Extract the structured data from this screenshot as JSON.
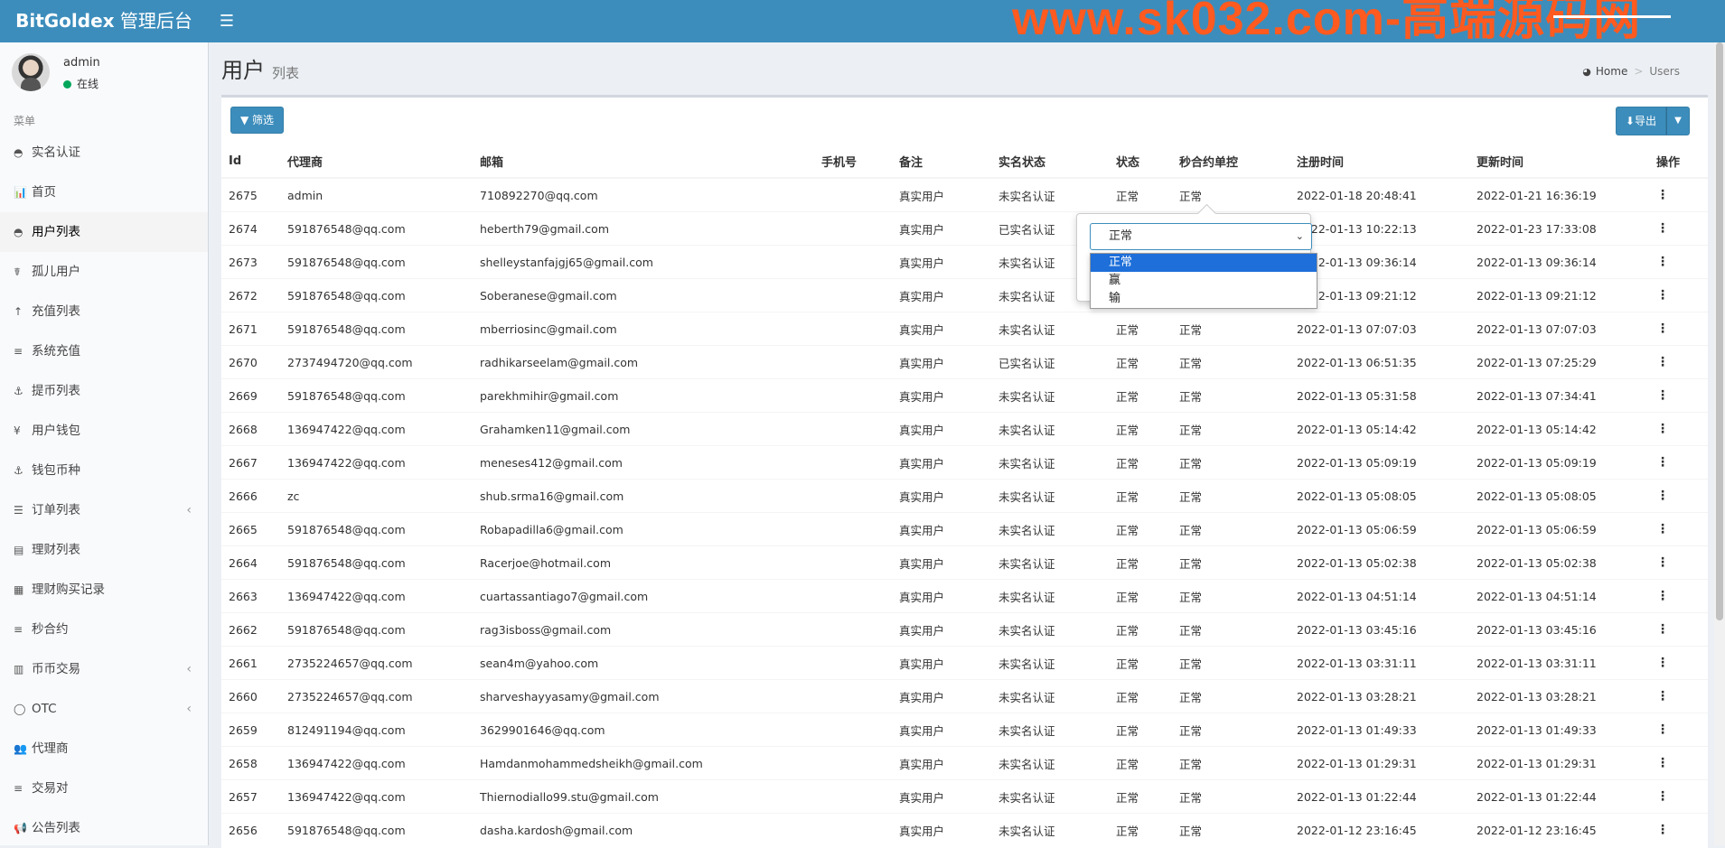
{
  "header": {
    "brand_bold": "BitGoldex",
    "brand_rest": " 管理后台",
    "toggle_icon": "hamburger-icon",
    "watermark": "www.sk032.com-高端源码网"
  },
  "user": {
    "name": "admin",
    "status": "在线"
  },
  "menu_header": "菜单",
  "menu": [
    {
      "icon": "◓",
      "label": "实名认证"
    },
    {
      "icon": "📊",
      "label": "首页"
    },
    {
      "icon": "◓",
      "label": "用户列表",
      "active": true
    },
    {
      "icon": "☤",
      "label": "孤儿用户"
    },
    {
      "icon": "↑",
      "label": "充值列表"
    },
    {
      "icon": "≡",
      "label": "系统充值"
    },
    {
      "icon": "⚓",
      "label": "提币列表"
    },
    {
      "icon": "¥",
      "label": "用户钱包"
    },
    {
      "icon": "⚓",
      "label": "钱包币种"
    },
    {
      "icon": "☰",
      "label": "订单列表",
      "caret": "‹"
    },
    {
      "icon": "▤",
      "label": "理财列表"
    },
    {
      "icon": "▦",
      "label": "理财购买记录"
    },
    {
      "icon": "≡",
      "label": "秒合约"
    },
    {
      "icon": "▥",
      "label": "币币交易",
      "caret": "‹"
    },
    {
      "icon": "◯",
      "label": "OTC",
      "caret": "‹"
    },
    {
      "icon": "👥",
      "label": "代理商"
    },
    {
      "icon": "≡",
      "label": "交易对"
    },
    {
      "icon": "📢",
      "label": "公告列表"
    }
  ],
  "page": {
    "title": "用户",
    "subtitle": "列表"
  },
  "breadcrumb": {
    "home": "Home",
    "current": "Users"
  },
  "toolbar": {
    "filter": "筛选",
    "export": "导出"
  },
  "table": {
    "headers": [
      "Id",
      "代理商",
      "邮箱",
      "手机号",
      "备注",
      "实名状态",
      "状态",
      "秒合约单控",
      "注册时间",
      "更新时间",
      "操作"
    ],
    "rows": [
      [
        "2675",
        "admin",
        "710892270@qq.com",
        "",
        "真实用户",
        "未实名认证",
        "正常",
        "正常",
        "2022-01-18 20:48:41",
        "2022-01-21 16:36:19",
        "⋮"
      ],
      [
        "2674",
        "591876548@qq.com",
        "heberth79@gmail.com",
        "",
        "真实用户",
        "已实名认证",
        "正常",
        "正常",
        "2022-01-13 10:22:13",
        "2022-01-23 17:33:08",
        "⋮"
      ],
      [
        "2673",
        "591876548@qq.com",
        "shelleystanfajgj65@gmail.com",
        "",
        "真实用户",
        "未实名认证",
        "正常",
        "正常",
        "2022-01-13 09:36:14",
        "2022-01-13 09:36:14",
        "⋮"
      ],
      [
        "2672",
        "591876548@qq.com",
        "Soberanese@gmail.com",
        "",
        "真实用户",
        "未实名认证",
        "正常",
        "正常",
        "2022-01-13 09:21:12",
        "2022-01-13 09:21:12",
        "⋮"
      ],
      [
        "2671",
        "591876548@qq.com",
        "mberriosinc@gmail.com",
        "",
        "真实用户",
        "未实名认证",
        "正常",
        "正常",
        "2022-01-13 07:07:03",
        "2022-01-13 07:07:03",
        "⋮"
      ],
      [
        "2670",
        "2737494720@qq.com",
        "radhikarseelam@gmail.com",
        "",
        "真实用户",
        "已实名认证",
        "正常",
        "正常",
        "2022-01-13 06:51:35",
        "2022-01-13 07:25:29",
        "⋮"
      ],
      [
        "2669",
        "591876548@qq.com",
        "parekhmihir@gmail.com",
        "",
        "真实用户",
        "未实名认证",
        "正常",
        "正常",
        "2022-01-13 05:31:58",
        "2022-01-13 07:34:41",
        "⋮"
      ],
      [
        "2668",
        "136947422@qq.com",
        "Grahamken11@gmail.com",
        "",
        "真实用户",
        "未实名认证",
        "正常",
        "正常",
        "2022-01-13 05:14:42",
        "2022-01-13 05:14:42",
        "⋮"
      ],
      [
        "2667",
        "136947422@qq.com",
        "meneses412@gmail.com",
        "",
        "真实用户",
        "未实名认证",
        "正常",
        "正常",
        "2022-01-13 05:09:19",
        "2022-01-13 05:09:19",
        "⋮"
      ],
      [
        "2666",
        "zc",
        "shub.srma16@gmail.com",
        "",
        "真实用户",
        "未实名认证",
        "正常",
        "正常",
        "2022-01-13 05:08:05",
        "2022-01-13 05:08:05",
        "⋮"
      ],
      [
        "2665",
        "591876548@qq.com",
        "Robapadilla6@gmail.com",
        "",
        "真实用户",
        "未实名认证",
        "正常",
        "正常",
        "2022-01-13 05:06:59",
        "2022-01-13 05:06:59",
        "⋮"
      ],
      [
        "2664",
        "591876548@qq.com",
        "Racerjoe@hotmail.com",
        "",
        "真实用户",
        "未实名认证",
        "正常",
        "正常",
        "2022-01-13 05:02:38",
        "2022-01-13 05:02:38",
        "⋮"
      ],
      [
        "2663",
        "136947422@qq.com",
        "cuartassantiago7@gmail.com",
        "",
        "真实用户",
        "未实名认证",
        "正常",
        "正常",
        "2022-01-13 04:51:14",
        "2022-01-13 04:51:14",
        "⋮"
      ],
      [
        "2662",
        "591876548@qq.com",
        "rag3isboss@gmail.com",
        "",
        "真实用户",
        "未实名认证",
        "正常",
        "正常",
        "2022-01-13 03:45:16",
        "2022-01-13 03:45:16",
        "⋮"
      ],
      [
        "2661",
        "2735224657@qq.com",
        "sean4m@yahoo.com",
        "",
        "真实用户",
        "未实名认证",
        "正常",
        "正常",
        "2022-01-13 03:31:11",
        "2022-01-13 03:31:11",
        "⋮"
      ],
      [
        "2660",
        "2735224657@qq.com",
        "sharveshayyasamy@gmail.com",
        "",
        "真实用户",
        "未实名认证",
        "正常",
        "正常",
        "2022-01-13 03:28:21",
        "2022-01-13 03:28:21",
        "⋮"
      ],
      [
        "2659",
        "812491194@qq.com",
        "3629901646@qq.com",
        "",
        "真实用户",
        "未实名认证",
        "正常",
        "正常",
        "2022-01-13 01:49:33",
        "2022-01-13 01:49:33",
        "⋮"
      ],
      [
        "2658",
        "136947422@qq.com",
        "Hamdanmohammedsheikh@gmail.com",
        "",
        "真实用户",
        "未实名认证",
        "正常",
        "正常",
        "2022-01-13 01:29:31",
        "2022-01-13 01:29:31",
        "⋮"
      ],
      [
        "2657",
        "136947422@qq.com",
        "Thiernodiallo99.stu@gmail.com",
        "",
        "真实用户",
        "未实名认证",
        "正常",
        "正常",
        "2022-01-13 01:22:44",
        "2022-01-13 01:22:44",
        "⋮"
      ],
      [
        "2656",
        "591876548@qq.com",
        "dasha.kardosh@gmail.com",
        "",
        "真实用户",
        "未实名认证",
        "正常",
        "正常",
        "2022-01-12 23:16:45",
        "2022-01-12 23:16:45",
        "⋮"
      ]
    ]
  },
  "popover": {
    "selected": "正常",
    "options": [
      "正常",
      "赢",
      "输"
    ],
    "highlighted": 0
  },
  "colors": {
    "primary": "#3c8dbc",
    "watermark": "#ff5a1f"
  }
}
